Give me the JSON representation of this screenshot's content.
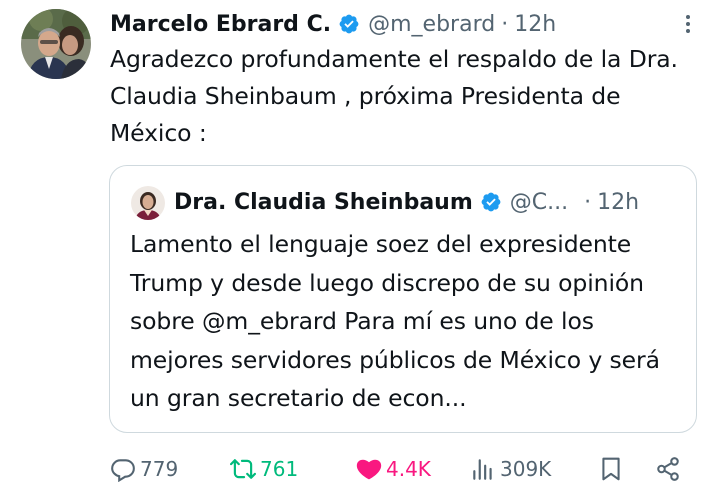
{
  "tweet": {
    "author_name": "Marcelo Ebrard C.",
    "handle": "@m_ebrard",
    "separator": "·",
    "time": "12h",
    "text": "Agradezco profundamente el respaldo de la Dra. Claudia Sheinbaum , próxima Presidenta de México :",
    "verified": true,
    "more_icon": "more-options-icon"
  },
  "quote": {
    "author_name": "Dra. Claudia Sheinbaum",
    "handle": "@C...",
    "separator": "·",
    "time": "12h",
    "verified": true,
    "text": "Lamento el lenguaje soez del expresidente Trump y desde luego discrepo de su opinión sobre @m_ebrard Para mí es uno de los mejores servidores públicos de México y será un gran secretario de econ..."
  },
  "actions": {
    "reply_count": "779",
    "retweet_count": "761",
    "like_count": "4.4K",
    "views_count": "309K"
  },
  "colors": {
    "text": "#0f1419",
    "muted": "#536471",
    "verified": "#1d9bf0",
    "retweet": "#00ba7c",
    "like": "#f91880",
    "border": "#cfd9de"
  }
}
